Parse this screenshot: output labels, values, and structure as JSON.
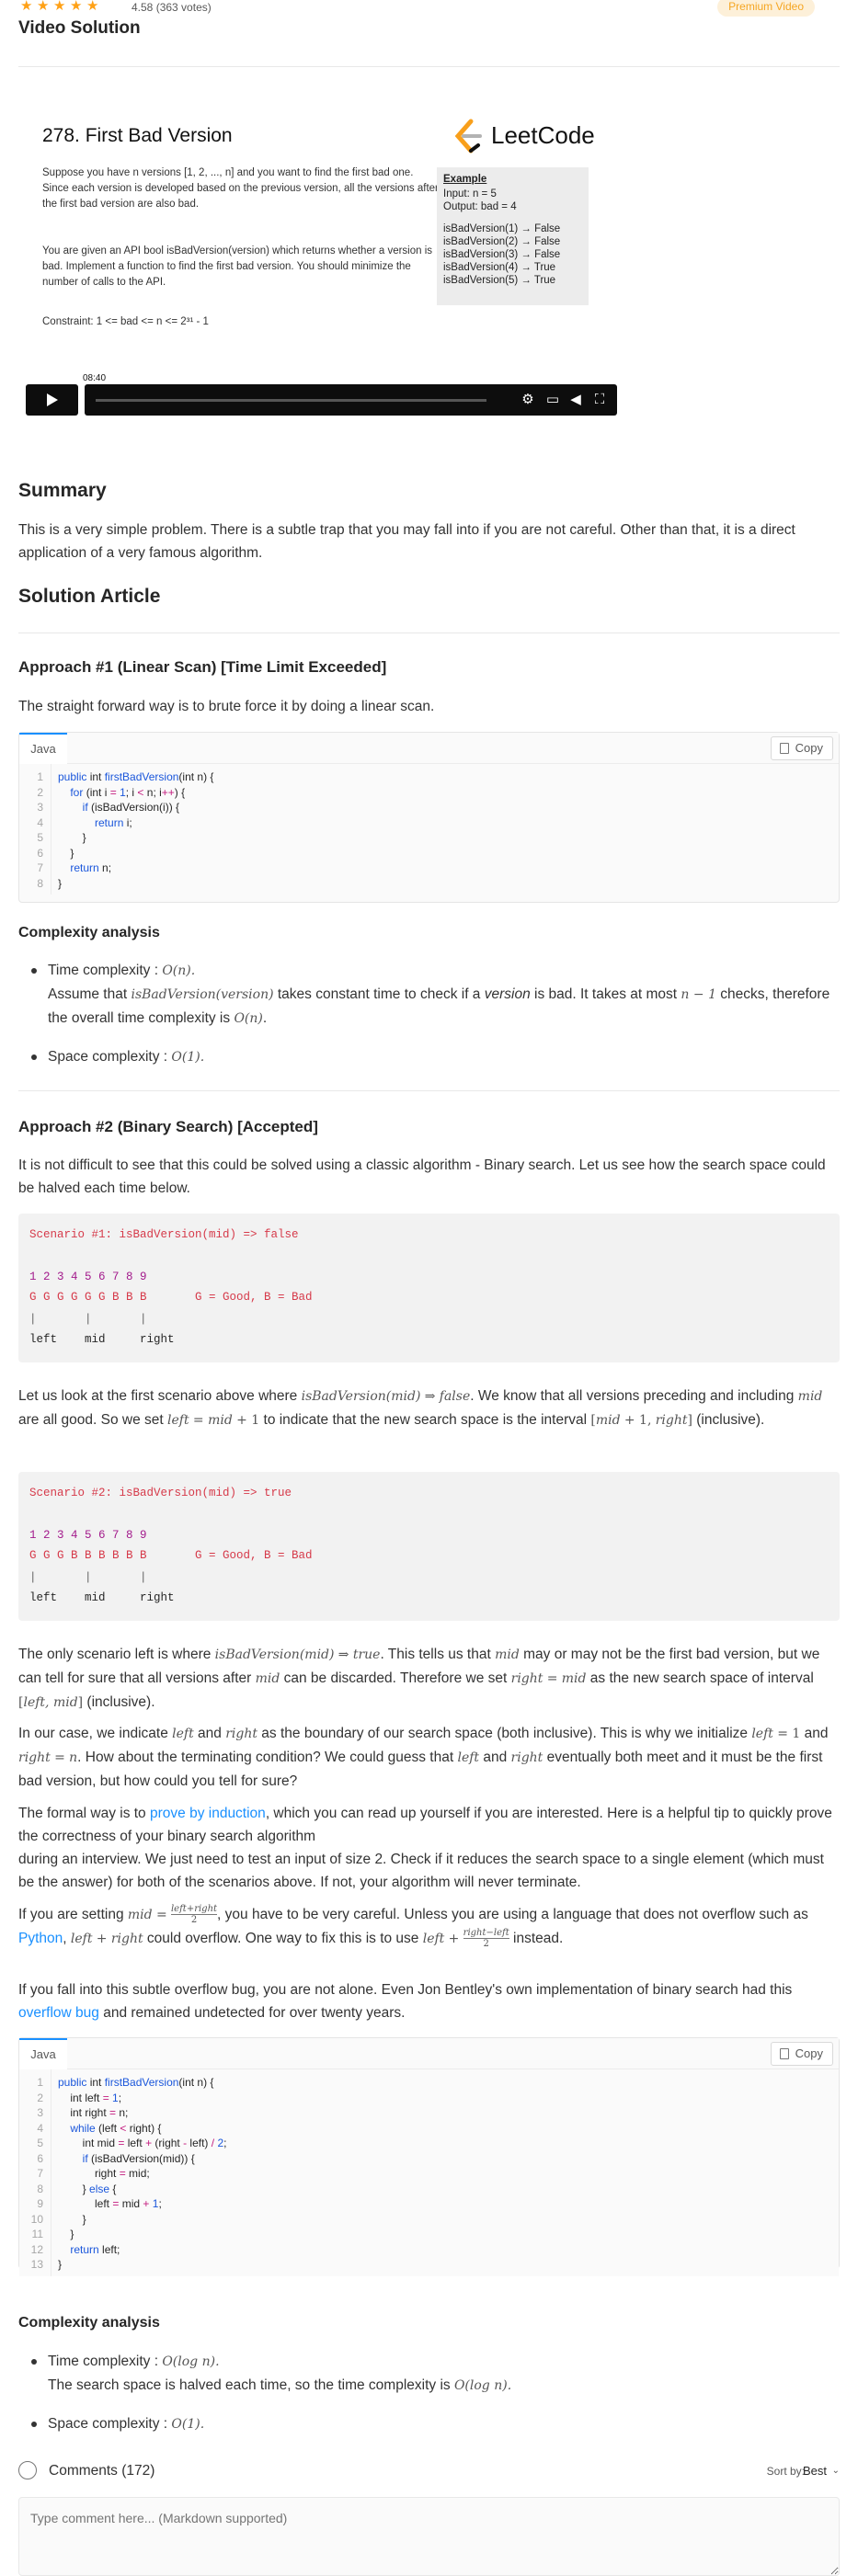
{
  "header": {
    "rating": "4.58",
    "votes": "(363 votes)",
    "premium_label": "Premium Video",
    "title": "Video Solution"
  },
  "video": {
    "slide_title": "278. First Bad Version",
    "para1": "Suppose you have n versions [1, 2, ..., n] and you want to find the first bad one. Since each version is developed based on the previous version, all the versions after the first bad version are also bad.",
    "para2": "You are given an API bool isBadVersion(version) which returns whether a version is bad. Implement a function to find the first bad version. You should minimize the number of calls to the API.",
    "constraint": "Constraint: 1 <= bad <= n <= 2³¹ - 1",
    "logo_text": "LeetCode",
    "example": {
      "heading": "Example",
      "input": "Input: n = 5",
      "output": "Output: bad = 4",
      "calls": [
        "isBadVersion(1) → False",
        "isBadVersion(2) → False",
        "isBadVersion(3) → False",
        "isBadVersion(4) → True",
        "isBadVersion(5) → True"
      ]
    },
    "time": "08:40",
    "progress": 0
  },
  "summary": {
    "heading": "Summary",
    "text": "This is a very simple problem. There is a subtle trap that you may fall into if you are not careful. Other than that, it is a direct application of a very famous algorithm."
  },
  "article": {
    "heading": "Solution Article"
  },
  "approach1": {
    "heading": "Approach #1 (Linear Scan) [Time Limit Exceeded]",
    "intro": "The straight forward way is to brute force it by doing a linear scan.",
    "tab": "Java",
    "copy": "Copy",
    "code": [
      "public int firstBadVersion(int n) {",
      "    for (int i = 1; i < n; i++) {",
      "        if (isBadVersion(i)) {",
      "            return i;",
      "        }",
      "    }",
      "    return n;",
      "}"
    ],
    "complexity_heading": "Complexity analysis",
    "time_label": "Time complexity :",
    "time_value": "O(n).",
    "time_explain_1": "Assume that",
    "time_explain_math": "isBadVersion(version)",
    "time_explain_2": "takes constant time to check if a",
    "time_explain_em": "version",
    "time_explain_3": "is bad. It takes at most",
    "time_explain_math2": "n − 1",
    "time_explain_4": "checks, therefore the overall time complexity is",
    "time_explain_math3": "O(n)",
    "space_label": "Space complexity :",
    "space_value": "O(1)."
  },
  "approach2": {
    "heading": "Approach #2 (Binary Search) [Accepted]",
    "intro": "It is not difficult to see that this could be solved using a classic algorithm - Binary search. Let us see how the search space could be halved each time below.",
    "scenario1": {
      "line1": "Scenario #1: isBadVersion(mid) => false",
      "nums": "1 2 3 4 5 6 7 8 9",
      "gb": "G G G G G G B B B       G = Good, B = Bad",
      "bars": "|       |       |",
      "labels": "left    mid     right"
    },
    "para_s1": "Let us look at the first scenario above where isBadVersion(mid) ⇒ false. We know that all versions preceding and including mid are all good. So we set left = mid + 1 to indicate that the new search space is the interval [mid + 1, right] (inclusive).",
    "scenario2": {
      "line1": "Scenario #2: isBadVersion(mid) => true",
      "nums": "1 2 3 4 5 6 7 8 9",
      "gb": "G G G B B B B B B       G = Good, B = Bad",
      "bars": "|       |       |",
      "labels": "left    mid     right"
    },
    "para_s2": "The only scenario left is where isBadVersion(mid) ⇒ true. This tells us that mid may or may not be the first bad version, but we can tell for sure that all versions after mid can be discarded. Therefore we set right = mid as the new search space of interval [left, mid] (inclusive).",
    "para_case": "In our case, we indicate left and right as the boundary of our search space (both inclusive). This is why we initialize left = 1 and right = n. How about the terminating condition? We could guess that left and right eventually both meet and it must be the first bad version, but how could you tell for sure?",
    "para_formal_1": "The formal way is to",
    "link_induction": "prove by induction",
    "para_formal_2": ", which you can read up yourself if you are interested. Here is a helpful tip to quickly prove the correctness of your binary search algorithm",
    "para_formal_3": "during an interview. We just need to test an input of size 2. Check if it reduces the search space to a single element (which must be the answer) for both of the scenarios above. If not, your algorithm will never terminate.",
    "para_mid_1": "If you are setting",
    "para_mid_2": ", you have to be very careful. Unless you are using a language that does not overflow such as",
    "link_python": "Python",
    "para_mid_3": "could overflow. One way to fix this is to use",
    "para_mid_4": "instead.",
    "para_bug_1": "If you fall into this subtle overflow bug, you are not alone. Even Jon Bentley's own implementation of binary search had this",
    "link_bug": "overflow bug",
    "para_bug_2": "and remained undetected for over twenty years.",
    "tab": "Java",
    "copy": "Copy",
    "code": [
      "public int firstBadVersion(int n) {",
      "    int left = 1;",
      "    int right = n;",
      "    while (left < right) {",
      "        int mid = left + (right - left) / 2;",
      "        if (isBadVersion(mid)) {",
      "            right = mid;",
      "        } else {",
      "            left = mid + 1;",
      "        }",
      "    }",
      "    return left;",
      "}"
    ],
    "complexity_heading": "Complexity analysis",
    "time_label": "Time complexity :",
    "time_value": "O(log n).",
    "time_explain": "The search space is halved each time, so the time complexity is",
    "time_explain_math": "O(log n).",
    "space_label": "Space complexity :",
    "space_value": "O(1)."
  },
  "comments": {
    "label": "Comments (172)",
    "sort_label": "Sort by:",
    "sort_value": "Best",
    "placeholder": "Type comment here... (Markdown supported)"
  },
  "colors": {
    "accent": "#ffa116",
    "link": "#1a90ff",
    "keyword": "#1a56db",
    "red": "#d63a4a"
  }
}
